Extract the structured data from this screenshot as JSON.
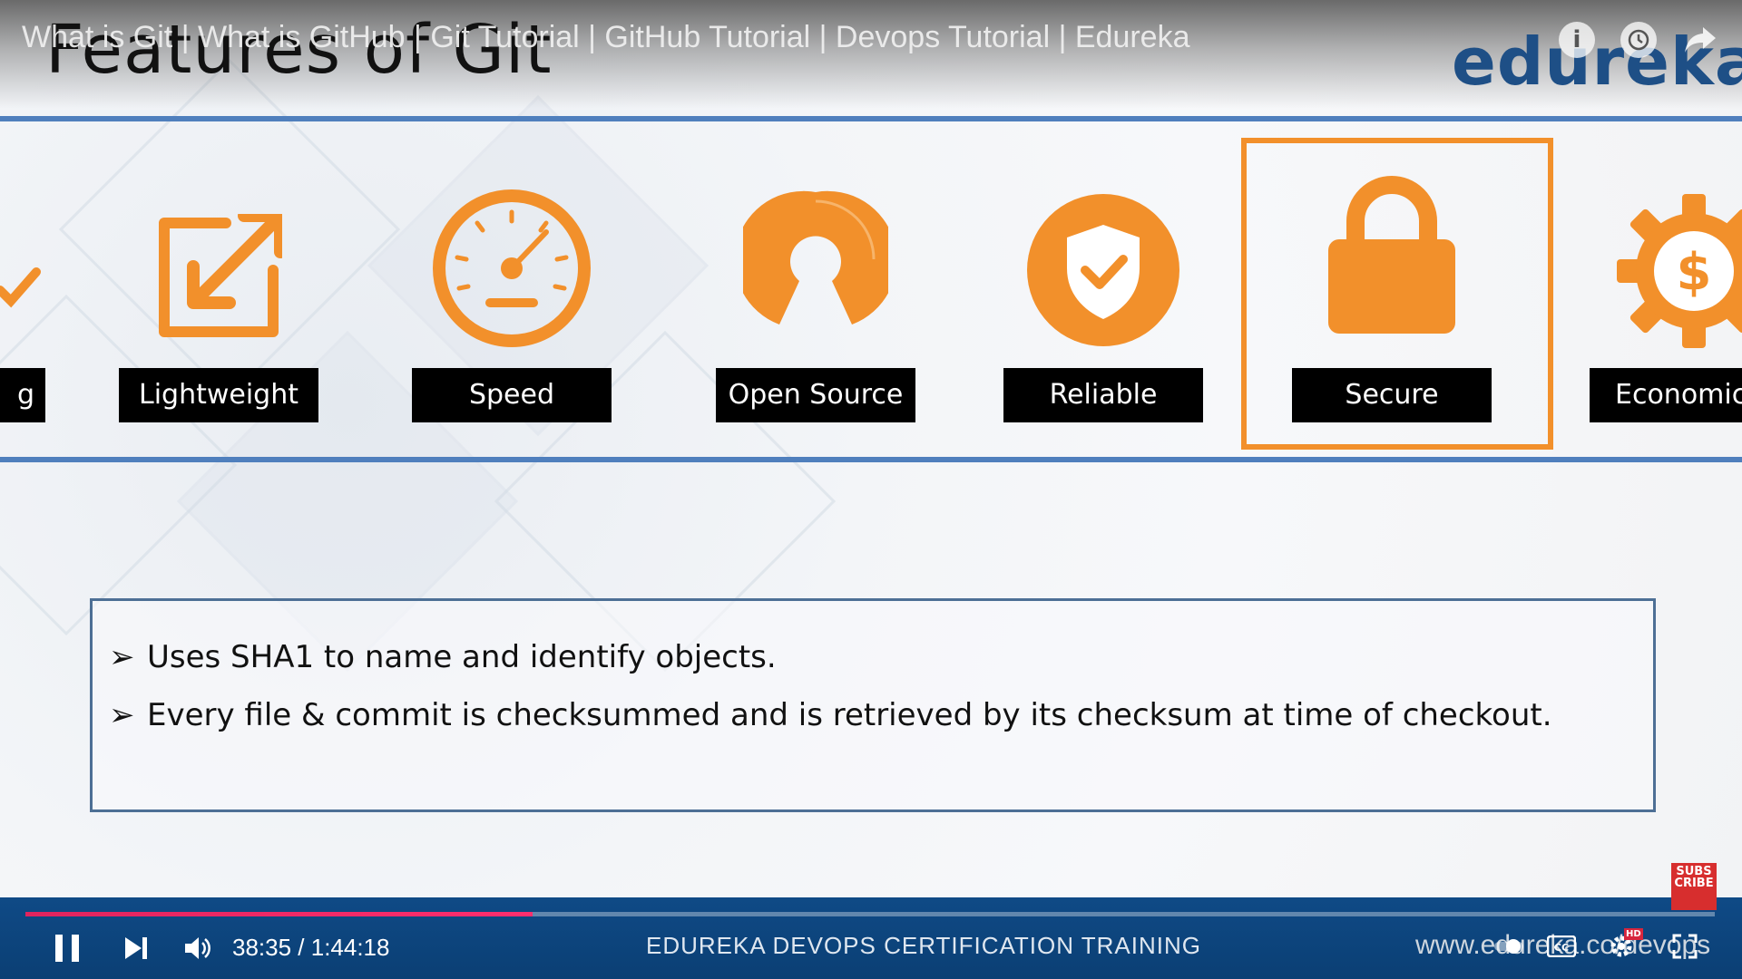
{
  "video": {
    "title": "What is Git | What is GitHub | Git Tutorial | GitHub Tutorial | Devops Tutorial | Edureka"
  },
  "slide": {
    "title": "Features of Git",
    "brand": "edureka!",
    "features": [
      {
        "label": "g",
        "icon": "partial-icon"
      },
      {
        "label": "Lightweight",
        "icon": "resize-arrow-icon"
      },
      {
        "label": "Speed",
        "icon": "speedometer-icon"
      },
      {
        "label": "Open Source",
        "icon": "open-source-icon"
      },
      {
        "label": "Reliable",
        "icon": "shield-check-icon"
      },
      {
        "label": "Secure",
        "icon": "padlock-icon"
      },
      {
        "label": "Economic",
        "icon": "gear-dollar-icon"
      }
    ],
    "highlighted_feature": "Secure",
    "bullets": [
      "Uses SHA1 to name and identify objects.",
      "Every file & commit is checksummed and is retrieved by its checksum at time of checkout."
    ],
    "accent_color": "#f2902b",
    "rule_color": "#4f7fbd"
  },
  "player": {
    "time": "38:35 / 1:44:18",
    "progress_fraction": 0.3,
    "footer_text": "EDUREKA DEVOPS CERTIFICATION TRAINING",
    "footer_url": "www.edureka.co/devops",
    "subscribe_label": "SUBS CRIBE",
    "hd_badge": "HD"
  }
}
